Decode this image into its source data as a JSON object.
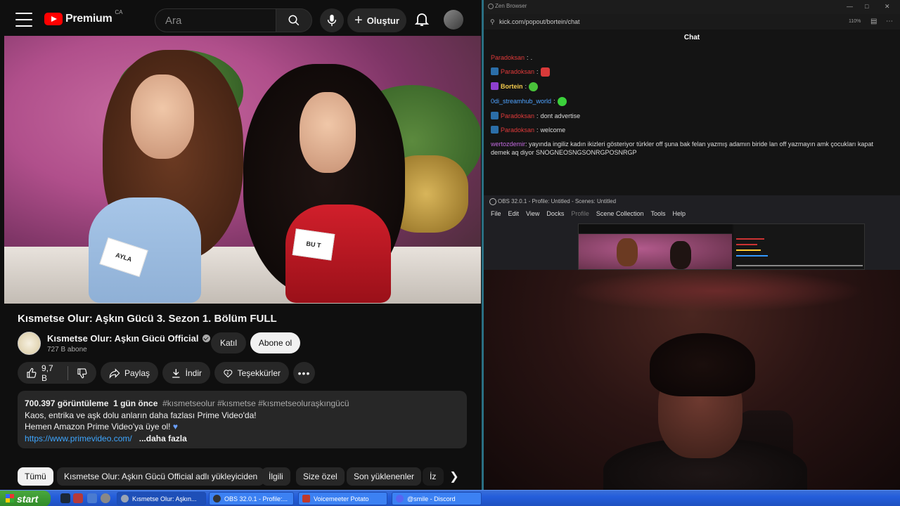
{
  "youtube": {
    "logo_text": "Premium",
    "region": "CA",
    "search_placeholder": "Ara",
    "create_label": "Oluştur",
    "video_name_tags": [
      "AYLA",
      "BU  T"
    ],
    "title": "Kısmetse Olur: Aşkın Gücü 3. Sezon 1. Bölüm FULL",
    "channel": {
      "name": "Kısmetse Olur: Aşkın Gücü Official",
      "subscribers": "727 B abone",
      "join_label": "Katıl",
      "subscribe_label": "Abone ol"
    },
    "actions": {
      "likes": "9,7 B",
      "share": "Paylaş",
      "download": "İndir",
      "thanks": "Teşekkürler"
    },
    "description": {
      "views": "700.397 görüntüleme",
      "age": "1 gün önce",
      "hashtags": "#kısmetseolur #kısmetse #kısmetseolurаşkıngücü",
      "line1": "Kaos, entrika ve aşk dolu anların daha fazlası Prime Video'da!",
      "line2": "Hemen Amazon Prime Video'ya üye ol!",
      "link": "https://www.primevideo.com/",
      "more": "...daha fazla"
    },
    "chips": [
      "Tümü",
      "Kısmetse Olur: Aşkın Gücü Official adlı yükleyiciden",
      "İlgili",
      "Size özel",
      "Son yüklenenler",
      "İz"
    ]
  },
  "browser": {
    "title": "Zen Browser",
    "url": "kick.com/popout/bortein/chat",
    "zoom": "110%",
    "chat_header": "Chat",
    "messages": [
      {
        "user": "Paradoksan",
        "text": ".",
        "badge": "none",
        "color": "red"
      },
      {
        "user": "Paradoksan",
        "text": "",
        "badge": "blue",
        "color": "red",
        "emote": "#d93a3a"
      },
      {
        "user": "Bortein",
        "text": "",
        "badge": "purple",
        "color": "yellow",
        "emote": "#49c23a"
      },
      {
        "user": "0di_streamhub_world",
        "text": "",
        "badge": "none",
        "color": "blue",
        "emote": "#3bd13b"
      },
      {
        "user": "Paradoksan",
        "text": "dont advertise",
        "badge": "blue",
        "color": "red"
      },
      {
        "user": "Paradoksan",
        "text": "welcome",
        "badge": "blue",
        "color": "red"
      },
      {
        "user": "wertozdemir",
        "text": "yayında ingiliz kadın ikizleri gösteriyor türkler off şuna bak felan yazmış adamın biride lan off yazmayın amk çocukları kapat demek aq diyor SNOGNEOSNGSONRGPOSNRGP",
        "badge": "none",
        "color": "purple"
      }
    ]
  },
  "obs": {
    "title": "OBS 32.0.1 - Profile: Untitled - Scenes: Untitled",
    "menu": [
      "File",
      "Edit",
      "View",
      "Docks",
      "Profile",
      "Scene Collection",
      "Tools",
      "Help"
    ]
  },
  "taskbar": {
    "start": "start",
    "tasks": [
      {
        "label": "Kısmetse Olur: Aşkın...",
        "icon_color": "#9aa4b4"
      },
      {
        "label": "OBS 32.0.1 - Profile:...",
        "icon_color": "#333333"
      },
      {
        "label": "Voicemeeter Potato",
        "icon_color": "#c0392b"
      },
      {
        "label": "@smile - Discord",
        "icon_color": "#5865f2"
      }
    ]
  }
}
